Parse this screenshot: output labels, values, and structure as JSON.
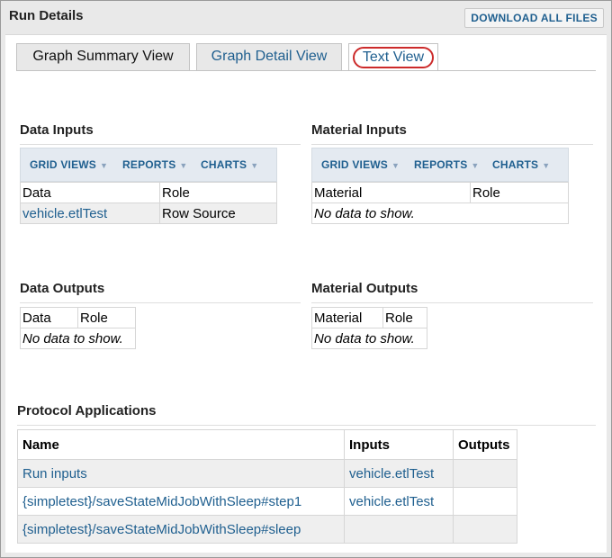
{
  "panel": {
    "title": "Run Details",
    "download_label": "DOWNLOAD ALL FILES"
  },
  "tabs": [
    "Graph Summary View",
    "Graph Detail View",
    "Text View"
  ],
  "data_inputs": {
    "title": "Data Inputs",
    "menu": [
      "GRID VIEWS",
      "REPORTS",
      "CHARTS"
    ],
    "columns": [
      "Data",
      "Role"
    ],
    "rows": [
      [
        "vehicle.etlTest",
        "Row Source"
      ]
    ]
  },
  "material_inputs": {
    "title": "Material Inputs",
    "menu": [
      "GRID VIEWS",
      "REPORTS",
      "CHARTS"
    ],
    "columns": [
      "Material",
      "Role"
    ],
    "empty": "No data to show."
  },
  "data_outputs": {
    "title": "Data Outputs",
    "columns": [
      "Data",
      "Role"
    ],
    "empty": "No data to show."
  },
  "material_outputs": {
    "title": "Material Outputs",
    "columns": [
      "Material",
      "Role"
    ],
    "empty": "No data to show."
  },
  "protocol": {
    "title": "Protocol Applications",
    "columns": [
      "Name",
      "Inputs",
      "Outputs"
    ],
    "rows": [
      [
        "Run inputs",
        "vehicle.etlTest",
        ""
      ],
      [
        "{simpletest}/saveStateMidJobWithSleep#step1",
        "vehicle.etlTest",
        ""
      ],
      [
        "{simpletest}/saveStateMidJobWithSleep#sleep",
        "",
        ""
      ]
    ]
  }
}
